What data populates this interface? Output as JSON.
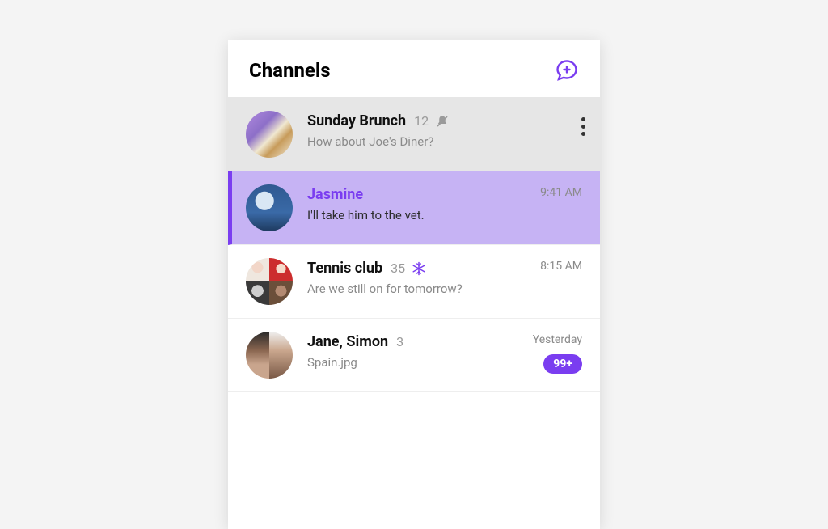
{
  "header": {
    "title": "Channels",
    "new_button": "new-message"
  },
  "colors": {
    "accent": "#7A3DF0",
    "selected_bg": "#C6B3F4"
  },
  "channels": [
    {
      "name": "Sunday Brunch",
      "member_count": "12",
      "preview": "How about Joe's Diner?",
      "timestamp": "",
      "badge": "",
      "status_icon": "muted",
      "state": "swiped",
      "action": "kebab"
    },
    {
      "name": "Jasmine",
      "member_count": "",
      "preview": "I'll take him to the vet.",
      "timestamp": "9:41 AM",
      "badge": "",
      "status_icon": "",
      "state": "selected",
      "action": ""
    },
    {
      "name": "Tennis club",
      "member_count": "35",
      "preview": "Are we still on for tomorrow?",
      "timestamp": "8:15 AM",
      "badge": "",
      "status_icon": "frozen",
      "state": "default",
      "action": ""
    },
    {
      "name": "Jane, Simon",
      "member_count": "3",
      "preview": "Spain.jpg",
      "timestamp": "Yesterday",
      "badge": "99+",
      "status_icon": "",
      "state": "default",
      "action": ""
    }
  ]
}
